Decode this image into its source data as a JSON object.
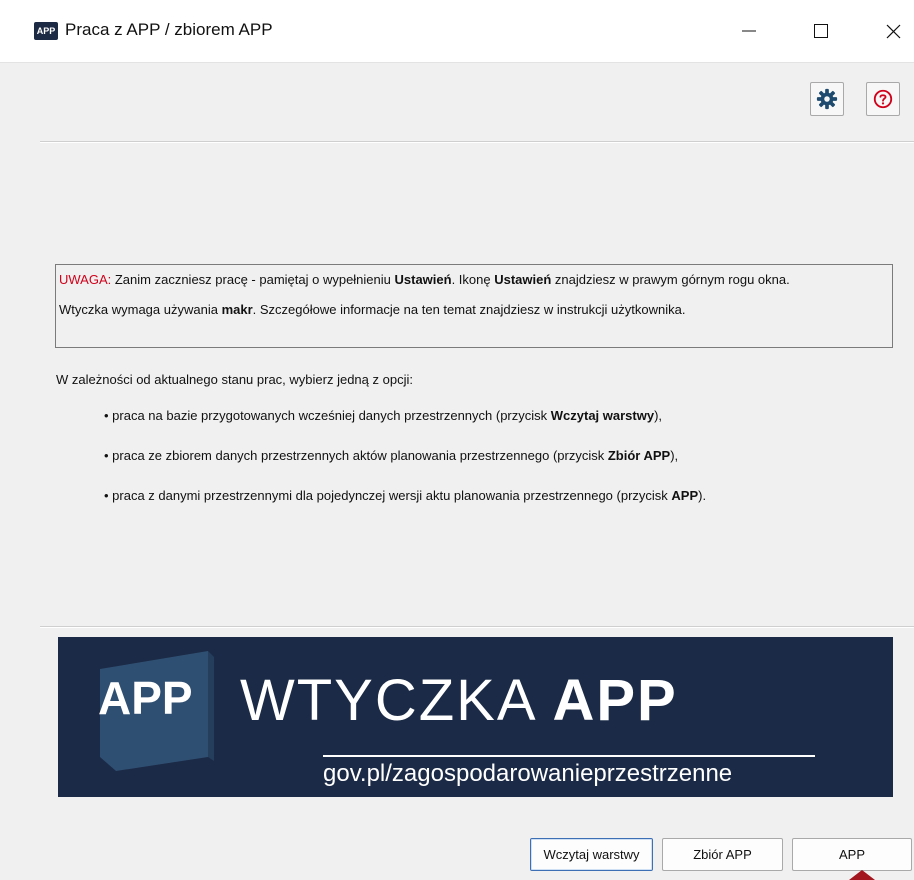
{
  "window": {
    "icon_text": "APP",
    "title": "Praca z APP / zbiorem APP",
    "minimize_glyph": "—",
    "maximize_glyph": "☐",
    "close_glyph": "✕"
  },
  "toolbar": {
    "settings_icon": "gear-icon",
    "help_icon": "question-circle-icon",
    "accent_settings": "#1d4a6e",
    "accent_help": "#d0021b"
  },
  "notice": {
    "label": "UWAGA:",
    "line1_a": " Zanim zaczniesz pracę - pamiętaj o wypełnieniu ",
    "line1_b": "Ustawień",
    "line1_c": ". Ikonę ",
    "line1_d": "Ustawień",
    "line1_e": " znajdziesz w prawym górnym rogu okna.",
    "line2_a": "Wtyczka wymaga używania ",
    "line2_b": "makr",
    "line2_c": ". Szczegółowe informacje na ten temat znajdziesz w instrukcji użytkownika."
  },
  "instructions": {
    "intro": "W zależności od aktualnego stanu prac, wybierz jedną z opcji:",
    "options": [
      {
        "prefix": "• praca na bazie przygotowanych wcześniej danych przestrzennych (przycisk ",
        "bold": "Wczytaj warstwy",
        "suffix": "),"
      },
      {
        "prefix": "• praca ze zbiorem danych przestrzennych aktów planowania przestrzennego (przycisk ",
        "bold": "Zbiór APP",
        "suffix": "),"
      },
      {
        "prefix": "• praca z danymi przestrzennymi dla pojedynczej wersji aktu planowania przestrzennego (przycisk ",
        "bold": "APP",
        "suffix": ")."
      }
    ]
  },
  "banner": {
    "badge": "APP",
    "title_light": "WTYCZKA ",
    "title_bold": "APP",
    "url": "gov.pl/zagospodarowanieprzestrzenne",
    "background": "#1b2a46"
  },
  "buttons": {
    "load_layers": "Wczytaj warstwy",
    "app_set": "Zbiór APP",
    "app": "APP"
  }
}
